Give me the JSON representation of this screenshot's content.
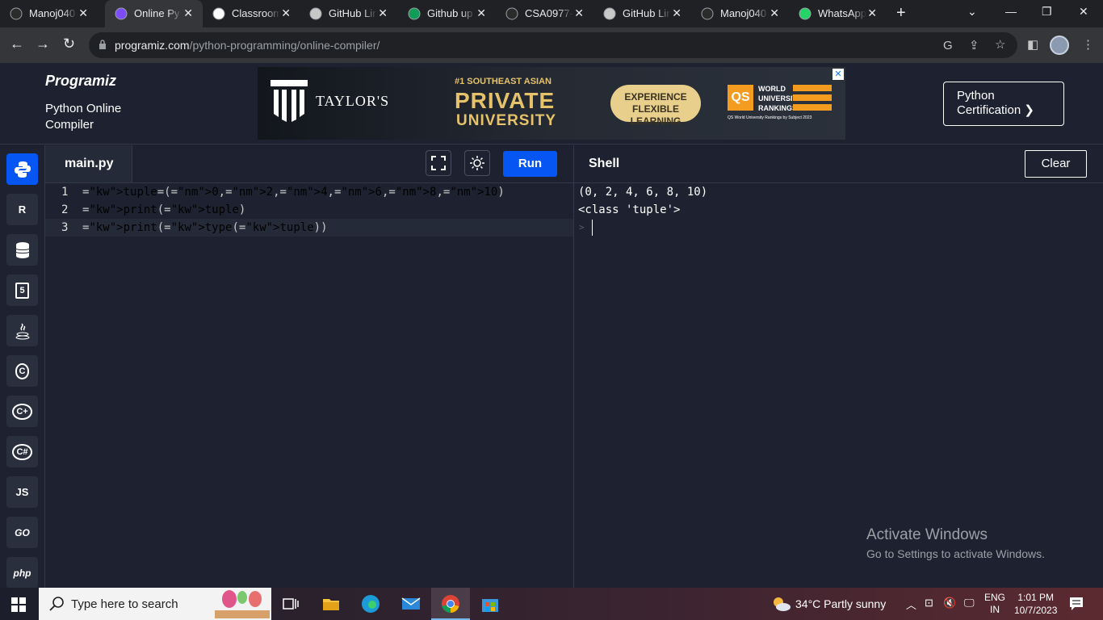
{
  "browser": {
    "tabs": [
      {
        "label": "Manoj040",
        "icon": "github-icon"
      },
      {
        "label": "Online Py",
        "icon": "programiz-icon",
        "active": true
      },
      {
        "label": "Classroom",
        "icon": "google-icon"
      },
      {
        "label": "GitHub Lir",
        "icon": "github-link-icon"
      },
      {
        "label": "Github up",
        "icon": "sheets-icon"
      },
      {
        "label": "CSA0977-",
        "icon": "github-icon"
      },
      {
        "label": "GitHub Lir",
        "icon": "github-link-icon"
      },
      {
        "label": "Manoj040",
        "icon": "github-icon"
      },
      {
        "label": "WhatsApp",
        "icon": "whatsapp-icon"
      }
    ],
    "close_glyph": "✕",
    "new_tab": "+",
    "url_domain": "programiz.com",
    "url_path": "/python-programming/online-compiler/"
  },
  "site": {
    "logo": "Programiz",
    "subtitle": "Python Online Compiler",
    "cert_button": "Python Certification ❯"
  },
  "ad": {
    "brand": "TAYLOR'S",
    "rank_line": "#1 SOUTHEAST ASIAN",
    "private": "PRIVATE",
    "university": "UNIVERSITY",
    "pill": "EXPERIENCE FLEXIBLE LEARNING",
    "qs": "QS",
    "qs_text": [
      "WORLD",
      "UNIVERSITY",
      "RANKINGS"
    ],
    "qs_sub": "QS World University Rankings by Subject 2023",
    "close": "✕"
  },
  "sidebar": {
    "languages": [
      {
        "name": "python",
        "label": "",
        "active": true
      },
      {
        "name": "r",
        "label": "R"
      },
      {
        "name": "sql",
        "label": ""
      },
      {
        "name": "html",
        "label": "5"
      },
      {
        "name": "java",
        "label": ""
      },
      {
        "name": "c",
        "label": "C"
      },
      {
        "name": "cpp",
        "label": "C+"
      },
      {
        "name": "csharp",
        "label": "C#"
      },
      {
        "name": "js",
        "label": "JS"
      },
      {
        "name": "go",
        "label": "GO"
      },
      {
        "name": "php",
        "label": "php"
      }
    ]
  },
  "editor": {
    "filename": "main.py",
    "run_label": "Run",
    "lines": [
      {
        "num": "1",
        "text": "tuple=(0,2,4,6,8,10)"
      },
      {
        "num": "2",
        "text": "print(tuple)"
      },
      {
        "num": "3",
        "text": "print(type(tuple))"
      }
    ]
  },
  "shell": {
    "title": "Shell",
    "clear_label": "Clear",
    "output": [
      "(0, 2, 4, 6, 8, 10)",
      "<class 'tuple'>"
    ],
    "prompt": ">"
  },
  "watermark": {
    "line1": "Activate Windows",
    "line2": "Go to Settings to activate Windows."
  },
  "taskbar": {
    "search_placeholder": "Type here to search",
    "weather": "34°C  Partly sunny",
    "lang": "ENG",
    "region": "IN",
    "time": "1:01 PM",
    "date": "10/7/2023"
  }
}
